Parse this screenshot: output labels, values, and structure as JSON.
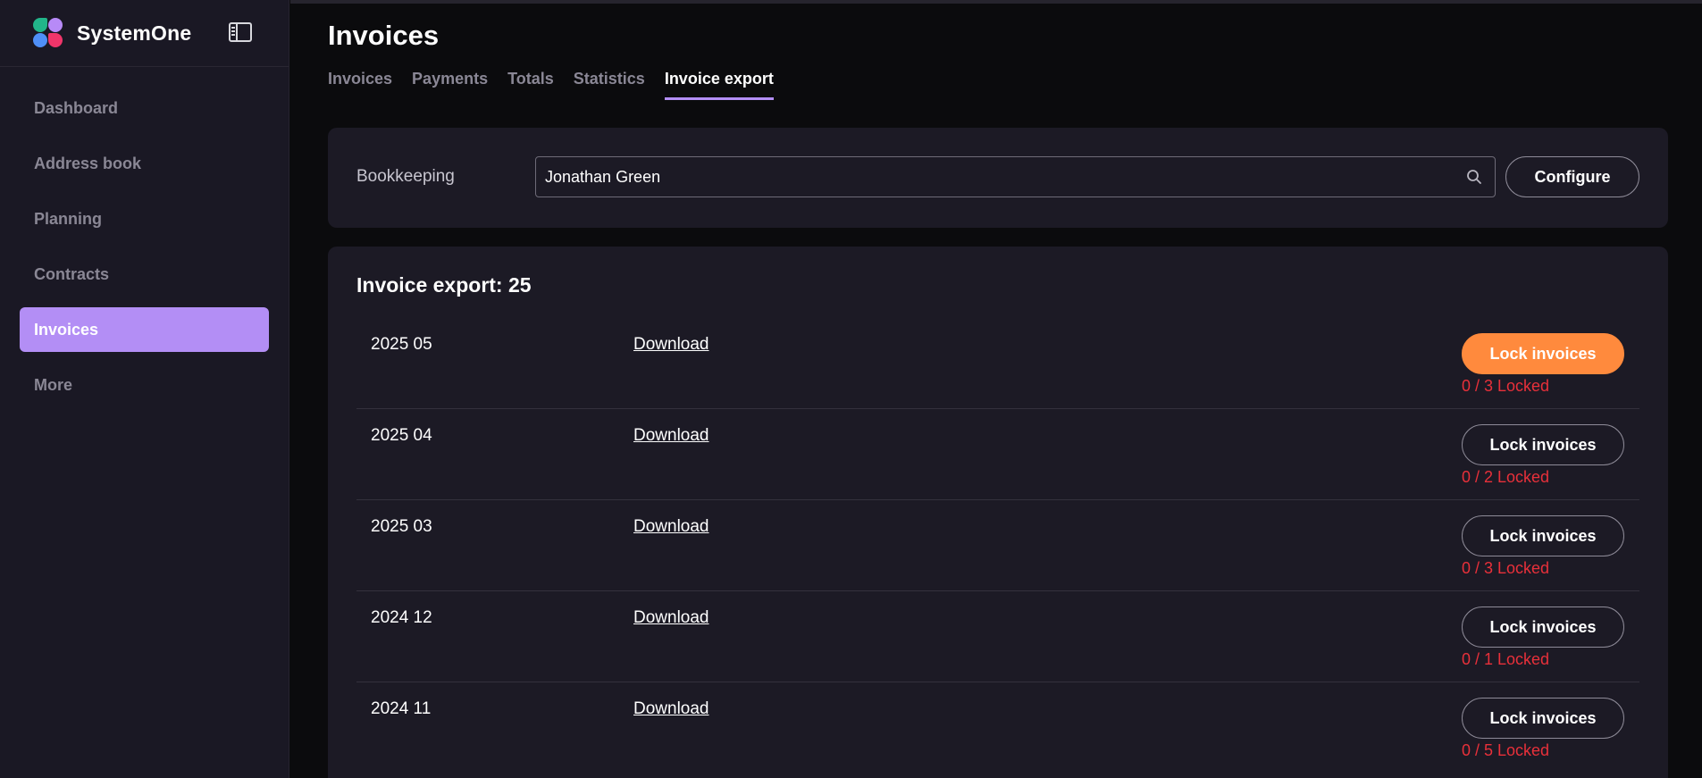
{
  "app": {
    "name": "SystemOne"
  },
  "sidebar": {
    "items": [
      {
        "label": "Dashboard",
        "active": false
      },
      {
        "label": "Address book",
        "active": false
      },
      {
        "label": "Planning",
        "active": false
      },
      {
        "label": "Contracts",
        "active": false
      },
      {
        "label": "Invoices",
        "active": true
      },
      {
        "label": "More",
        "active": false
      }
    ]
  },
  "page": {
    "title": "Invoices"
  },
  "tabs": [
    {
      "label": "Invoices",
      "active": false
    },
    {
      "label": "Payments",
      "active": false
    },
    {
      "label": "Totals",
      "active": false
    },
    {
      "label": "Statistics",
      "active": false
    },
    {
      "label": "Invoice export",
      "active": true
    }
  ],
  "filter": {
    "label": "Bookkeeping",
    "value": "Jonathan Green",
    "configure_label": "Configure"
  },
  "export": {
    "title": "Invoice export: 25",
    "download_label": "Download",
    "lock_label": "Lock invoices",
    "rows": [
      {
        "period": "2025 05",
        "status": "0 / 3 Locked"
      },
      {
        "period": "2025 04",
        "status": "0 / 2 Locked"
      },
      {
        "period": "2025 03",
        "status": "0 / 3 Locked"
      },
      {
        "period": "2024 12",
        "status": "0 / 1 Locked"
      },
      {
        "period": "2024 11",
        "status": "0 / 5 Locked"
      }
    ]
  },
  "colors": {
    "accent": "#b38ef5",
    "primary_button": "#ff8a3d",
    "status_text": "#e8303a",
    "sidebar_bg": "#1a1824",
    "card_bg": "#1c1a25"
  },
  "icons": {
    "logo": "systemone-logo-icon",
    "sidebar_toggle": "sidebar-toggle-icon",
    "search": "search-icon"
  }
}
